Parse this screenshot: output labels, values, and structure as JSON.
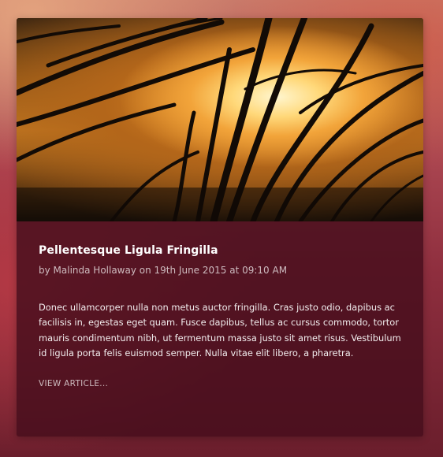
{
  "article": {
    "title": "Pellentesque Ligula Fringilla",
    "meta": "by Malinda Hollaway on 19th June 2015 at 09:10 AM",
    "body": "Donec ullamcorper nulla non metus auctor fringilla. Cras justo odio, dapibus ac facilisis in, egestas eget quam. Fusce dapibus, tellus ac cursus commodo, tortor mauris condimentum nibh, ut fermentum massa justo sit amet risus. Vestibulum id ligula porta felis euismod semper. Nulla vitae elit libero, a pharetra.",
    "link_label": "VIEW ARTICLE..."
  },
  "colors": {
    "card_background": "#460e1c",
    "title_color": "#ffffff",
    "sunset_highlight": "#ffd879"
  },
  "image": {
    "subject": "sunset-through-grass-photo"
  }
}
